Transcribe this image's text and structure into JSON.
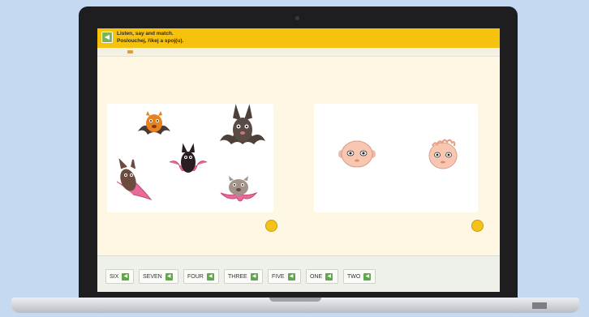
{
  "instructions": {
    "english": "Listen, say and match.",
    "czech": "Poslouchej, říkej a spoj(u)."
  },
  "icons": {
    "back": "back-arrow-icon",
    "speaker": "speaker-icon"
  },
  "panels": {
    "left": {
      "content": "bats",
      "count": 5
    },
    "right": {
      "content": "baby-faces",
      "count": 2
    }
  },
  "word_cards": [
    "SIX",
    "SEVEN",
    "FOUR",
    "THREE",
    "FIVE",
    "ONE",
    "TWO"
  ],
  "colors": {
    "header": "#f7c20e",
    "screen_bg": "#fdf7e4",
    "drop_dot": "#f4c31a",
    "speaker": "#5fa84a",
    "background": "#c5daf0"
  }
}
